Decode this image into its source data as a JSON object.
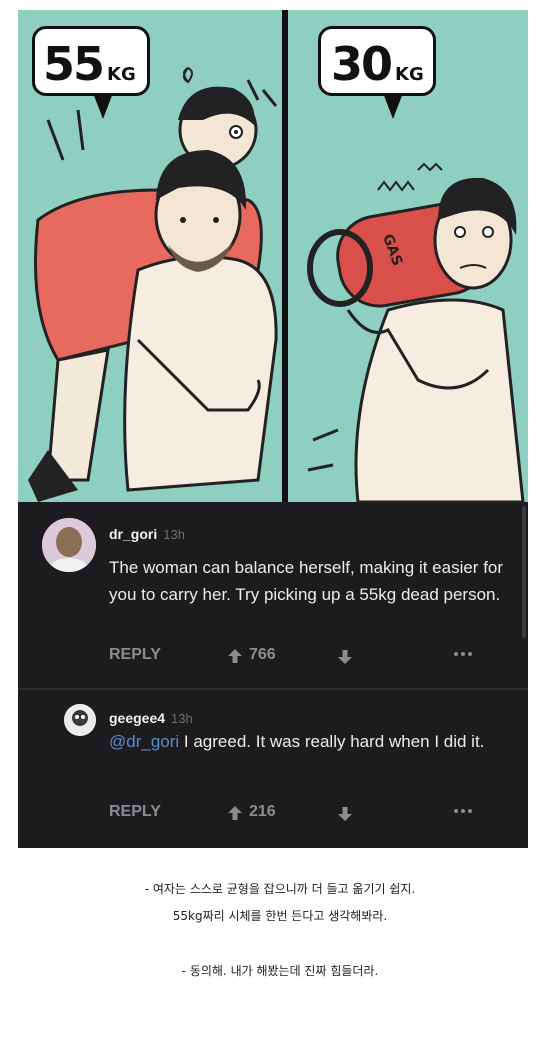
{
  "comic": {
    "left_panel_label_number": "55",
    "left_panel_label_unit": "KG",
    "right_panel_label_number": "30",
    "right_panel_label_unit": "KG",
    "tank_text": "GAS"
  },
  "comments": [
    {
      "username": "dr_gori",
      "time": "13h",
      "body": "The woman can balance herself, making it easier for you to carry her. Try picking up a 55kg dead person.",
      "reply_label": "REPLY",
      "upvotes": "766"
    },
    {
      "username": "geegee4",
      "time": "13h",
      "mention": "@dr_gori",
      "body": " I agreed. It was really hard when I did it.",
      "reply_label": "REPLY",
      "upvotes": "216"
    }
  ],
  "caption": {
    "line1": "- 여자는 스스로 균형을 잡으니까 더 들고 옮기기 쉽지.",
    "line2": "55kg짜리 시체를 한번 든다고 생각해봐라.",
    "line3": "- 동의해. 내가 해봤는데 진짜 힘들더라."
  },
  "colors": {
    "comic_background": "#8fcfc0",
    "card_background": "#1c1c1e",
    "mention_color": "#5b8ac9"
  }
}
